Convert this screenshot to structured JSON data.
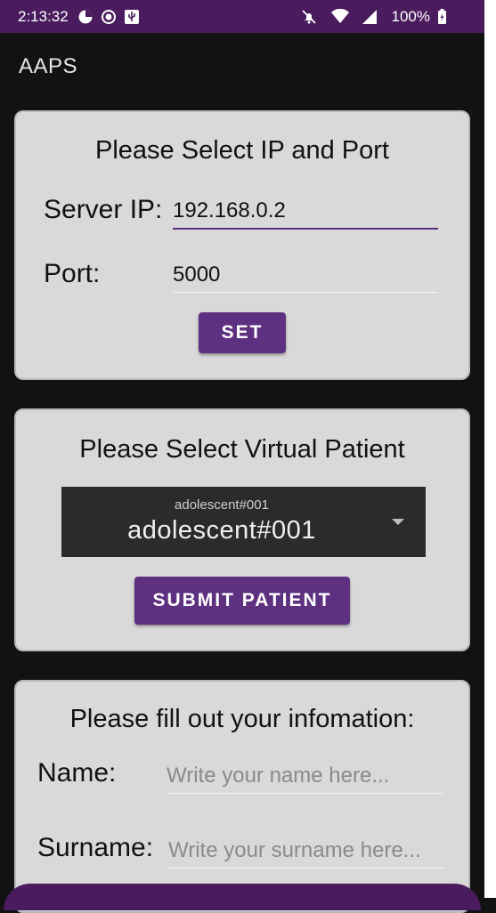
{
  "status_bar": {
    "time": "2:13:32",
    "battery": "100%",
    "icons": [
      "data-saver-icon",
      "record-icon",
      "usb-icon",
      "mute-icon",
      "wifi-icon",
      "signal-icon",
      "battery-charging-icon"
    ]
  },
  "app": {
    "title": "AAPS"
  },
  "server_card": {
    "title": "Please Select IP and Port",
    "ip_label": "Server IP:",
    "ip_value": "192.168.0.2",
    "port_label": "Port:",
    "port_value": "5000",
    "set_button": "SET"
  },
  "patient_card": {
    "title": "Please Select Virtual Patient",
    "spinner_hint": "adolescent#001",
    "spinner_value": "adolescent#001",
    "submit_button": "SUBMIT PATIENT"
  },
  "info_card": {
    "title": "Please fill out your infomation:",
    "name_label": "Name:",
    "name_placeholder": "Write your name here...",
    "surname_label": "Surname:",
    "surname_placeholder": "Write your surname here..."
  },
  "colors": {
    "primary": "#5e3080",
    "status_bar": "#4a1c5e",
    "card_bg": "#d9d9d9",
    "background": "#121212"
  }
}
